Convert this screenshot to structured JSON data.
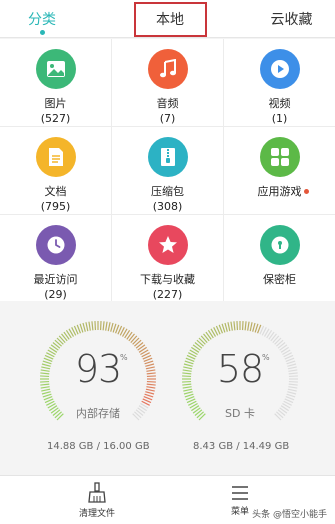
{
  "tabs": [
    {
      "label": "分类",
      "active": true
    },
    {
      "label": "本地",
      "active": false,
      "highlighted": true
    },
    {
      "label": "云收藏",
      "active": false
    }
  ],
  "categories": [
    {
      "label": "图片",
      "count": "(527)",
      "icon": "image-icon",
      "color": "#3cb878"
    },
    {
      "label": "音频",
      "count": "(7)",
      "icon": "music-note-icon",
      "color": "#f0603a"
    },
    {
      "label": "视频",
      "count": "(1)",
      "icon": "play-icon",
      "color": "#3d8fe8"
    },
    {
      "label": "文档",
      "count": "(795)",
      "icon": "document-icon",
      "color": "#f4b52a"
    },
    {
      "label": "压缩包",
      "count": "(308)",
      "icon": "zip-icon",
      "color": "#2cb2c4"
    },
    {
      "label": "应用游戏",
      "count": "",
      "icon": "apps-icon",
      "color": "#5cb947",
      "badge": true
    },
    {
      "label": "最近访问",
      "count": "(29)",
      "icon": "clock-icon",
      "color": "#7a5ab0"
    },
    {
      "label": "下载与收藏",
      "count": "(227)",
      "icon": "star-icon",
      "color": "#e8485e"
    },
    {
      "label": "保密柜",
      "count": "",
      "icon": "safe-icon",
      "color": "#30b588"
    }
  ],
  "storage": {
    "internal": {
      "percent": "93",
      "percent_sign": "%",
      "label": "内部存储",
      "size": "14.88 GB / 16.00 GB",
      "fraction": 0.93
    },
    "sd": {
      "percent": "58",
      "percent_sign": "%",
      "label": "SD 卡",
      "size": "8.43 GB / 14.49 GB",
      "fraction": 0.58
    }
  },
  "bottombar": {
    "clean_label": "清理文件",
    "menu_label": "菜单",
    "watermark": "头条 @悟空小能手"
  },
  "colors": {
    "accent": "#2ab7b7",
    "highlight_border": "#c9353a",
    "gauge_green": "#9bd66a",
    "gauge_red": "#f06a5c",
    "gauge_track": "#dcdcdc"
  }
}
